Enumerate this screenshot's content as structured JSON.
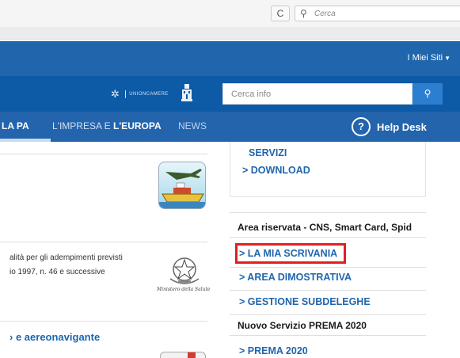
{
  "browser": {
    "reload_glyph": "C",
    "search_placeholder": "Cerca",
    "search_icon": "search-icon"
  },
  "topbar": {
    "sites_label": "I Miei Siti",
    "caret_icon": "caret-down-icon"
  },
  "header": {
    "partner_logo_text": "UNIONCAMERE",
    "search_placeholder": "Cerca info",
    "search_button_icon": "search-icon"
  },
  "nav": {
    "pa_fragment": "LA PA",
    "impresa_prefix": "L'IMPRESA E ",
    "impresa_bold": "L'EUROPA",
    "news": "NEWS",
    "help_icon": "?",
    "help_label": "Help Desk"
  },
  "left": {
    "text_line_1": "alità per gli adempimenti previsti",
    "text_line_2": "io 1997, n. 46 e successive",
    "emblem_caption": "Ministero della Salute",
    "link_fragment": "e aereonavigante"
  },
  "right": {
    "servizi": "SERVIZI",
    "download": "> DOWNLOAD",
    "area_riservata_title": "Area riservata - CNS, Smart Card, Spid",
    "mia_scrivania": "> LA MIA SCRIVANIA",
    "area_dimostrativa": "> AREA DIMOSTRATIVA",
    "gestione_subdeleghe": "> GESTIONE SUBDELEGHE",
    "prema_title": "Nuovo Servizio PREMA 2020",
    "prema_2020": "> PREMA 2020"
  },
  "colors": {
    "brand_blue": "#1f66ad",
    "nav_blue": "#2364ad",
    "highlight_red": "#e02020"
  }
}
